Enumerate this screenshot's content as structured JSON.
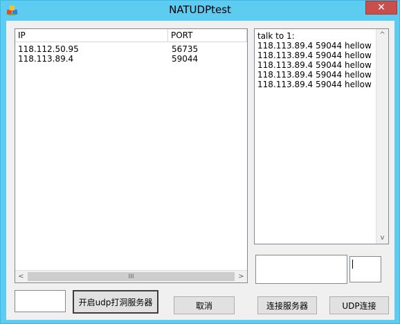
{
  "window": {
    "title": "NATUDPtest",
    "close_glyph": "✕"
  },
  "peers_list": {
    "columns": [
      "IP",
      "PORT"
    ],
    "rows": [
      {
        "ip": "118.112.50.95",
        "port": "56735"
      },
      {
        "ip": "118.113.89.4",
        "port": "59044"
      }
    ],
    "scroll_left": "<",
    "scroll_right": ">",
    "scroll_grip": "III"
  },
  "chat_log": {
    "lines": [
      "talk to 1:",
      "118.113.89.4 59044 hellow",
      "118.113.89.4 59044 hellow",
      "118.113.89.4 59044 hellow",
      "118.113.89.4 59044 hellow",
      "118.113.89.4 59044 hellow"
    ],
    "scroll_up": "^",
    "scroll_down": "v"
  },
  "message_input": {
    "value": ""
  },
  "target_input": {
    "value": ""
  },
  "port_input": {
    "value": ""
  },
  "buttons": {
    "start_server": "开启udp打洞服务器",
    "cancel": "取消",
    "connect_server": "连接服务器",
    "udp_connect": "UDP连接"
  }
}
